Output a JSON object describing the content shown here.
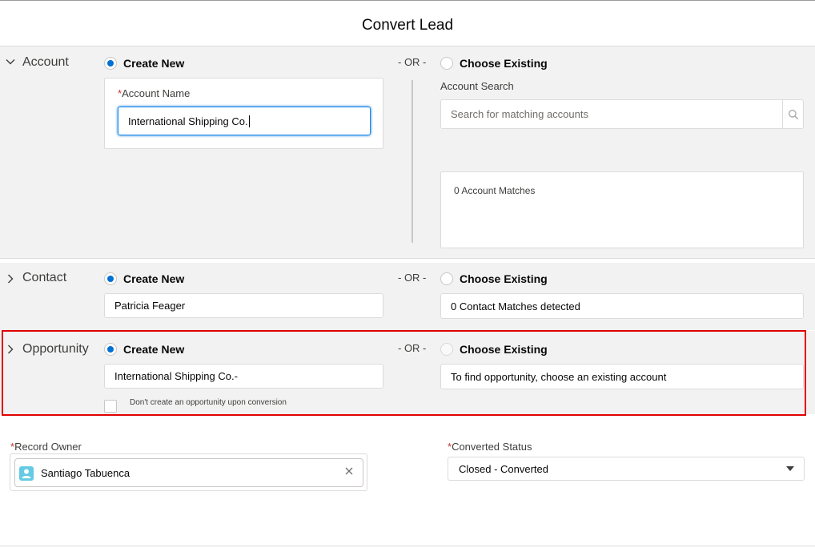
{
  "modal": {
    "title": "Convert Lead"
  },
  "or_label": "- OR -",
  "account": {
    "section_label": "Account",
    "create_new_label": "Create New",
    "choose_existing_label": "Choose Existing",
    "create_new_selected": true,
    "name_label": "Account Name",
    "name_required": "*",
    "name_value": "International Shipping Co.",
    "search_label": "Account Search",
    "search_placeholder": "Search for matching accounts",
    "matches_text": "0 Account Matches"
  },
  "contact": {
    "section_label": "Contact",
    "create_new_label": "Create New",
    "choose_existing_label": "Choose Existing",
    "create_new_selected": true,
    "name_value": "Patricia Feager",
    "matches_text": "0 Contact Matches detected"
  },
  "opportunity": {
    "section_label": "Opportunity",
    "create_new_label": "Create New",
    "choose_existing_label": "Choose Existing",
    "create_new_selected": true,
    "name_value": "International Shipping Co.-",
    "existing_hint": "To find opportunity, choose an existing account",
    "dont_create_label": "Don't create an opportunity upon conversion",
    "dont_create_checked": false
  },
  "record_owner": {
    "label": "Record Owner",
    "required": "*",
    "value": "Santiago Tabuenca"
  },
  "converted_status": {
    "label": "Converted Status",
    "required": "*",
    "value": "Closed - Converted"
  },
  "colors": {
    "brand": "#0070d2",
    "required": "#c23934",
    "highlight": "#e00000",
    "section_bg": "#f3f2f2",
    "avatar": "#65cae4"
  },
  "icons": {
    "account_toggle": "chevron-down-icon",
    "contact_toggle": "chevron-right-icon",
    "opportunity_toggle": "chevron-right-icon",
    "search": "search-icon",
    "owner_avatar": "user-icon",
    "remove": "close-icon",
    "dropdown": "caret-down-icon"
  }
}
